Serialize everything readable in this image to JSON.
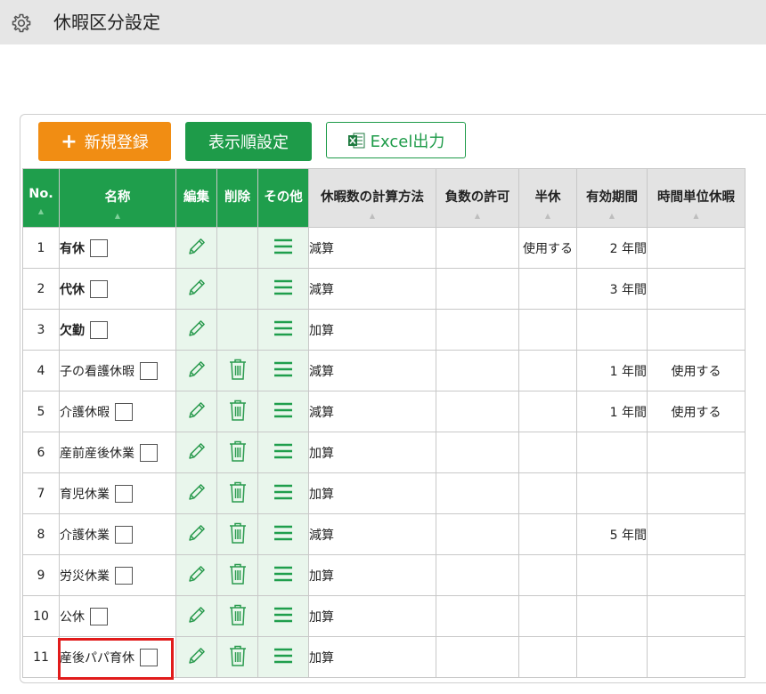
{
  "page": {
    "title": "休暇区分設定",
    "title_icon": "gear-icon"
  },
  "toolbar": {
    "new_label": "新規登録",
    "order_label": "表示順設定",
    "excel_label": "Excel出力"
  },
  "colors": {
    "green": "#1f9e4c",
    "orange": "#f18d13",
    "highlight": "#e11b1b"
  },
  "columns": {
    "no": "No.",
    "name": "名称",
    "edit": "編集",
    "delete": "削除",
    "other": "その他",
    "calc": "休暇数の計算方法",
    "negative": "負数の許可",
    "half": "半休",
    "validity": "有効期間",
    "hourly": "時間単位休暇"
  },
  "rows": [
    {
      "no": "1",
      "name": "有休",
      "bold": true,
      "deletable": false,
      "calc": "減算",
      "negative": "",
      "half": "使用する",
      "validity": "2 年間",
      "hourly": ""
    },
    {
      "no": "2",
      "name": "代休",
      "bold": true,
      "deletable": false,
      "calc": "減算",
      "negative": "",
      "half": "",
      "validity": "3 年間",
      "hourly": ""
    },
    {
      "no": "3",
      "name": "欠勤",
      "bold": true,
      "deletable": false,
      "calc": "加算",
      "negative": "",
      "half": "",
      "validity": "",
      "hourly": ""
    },
    {
      "no": "4",
      "name": "子の看護休暇",
      "bold": false,
      "deletable": true,
      "calc": "減算",
      "negative": "",
      "half": "",
      "validity": "1 年間",
      "hourly": "使用する"
    },
    {
      "no": "5",
      "name": "介護休暇",
      "bold": false,
      "deletable": true,
      "calc": "減算",
      "negative": "",
      "half": "",
      "validity": "1 年間",
      "hourly": "使用する"
    },
    {
      "no": "6",
      "name": "産前産後休業",
      "bold": false,
      "deletable": true,
      "calc": "加算",
      "negative": "",
      "half": "",
      "validity": "",
      "hourly": ""
    },
    {
      "no": "7",
      "name": "育児休業",
      "bold": false,
      "deletable": true,
      "calc": "加算",
      "negative": "",
      "half": "",
      "validity": "",
      "hourly": ""
    },
    {
      "no": "8",
      "name": "介護休業",
      "bold": false,
      "deletable": true,
      "calc": "減算",
      "negative": "",
      "half": "",
      "validity": "5 年間",
      "hourly": ""
    },
    {
      "no": "9",
      "name": "労災休業",
      "bold": false,
      "deletable": true,
      "calc": "加算",
      "negative": "",
      "half": "",
      "validity": "",
      "hourly": ""
    },
    {
      "no": "10",
      "name": "公休",
      "bold": false,
      "deletable": true,
      "calc": "加算",
      "negative": "",
      "half": "",
      "validity": "",
      "hourly": ""
    },
    {
      "no": "11",
      "name": "産後パパ育休",
      "bold": false,
      "deletable": true,
      "calc": "加算",
      "negative": "",
      "half": "",
      "validity": "",
      "hourly": ""
    }
  ]
}
